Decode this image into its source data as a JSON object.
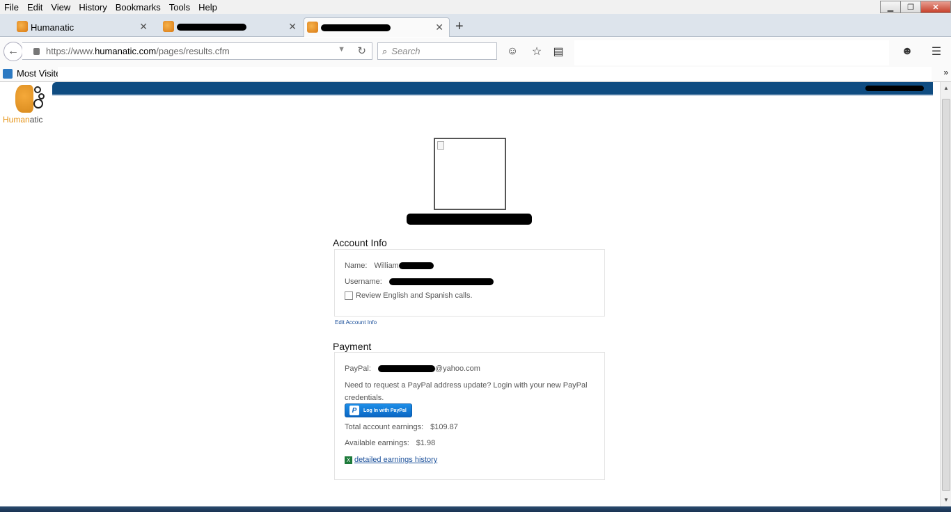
{
  "menubar": {
    "items": [
      "File",
      "Edit",
      "View",
      "History",
      "Bookmarks",
      "Tools",
      "Help"
    ]
  },
  "tabs": [
    {
      "label": "Humanatic"
    },
    {
      "label": ""
    },
    {
      "label": ""
    }
  ],
  "navbar": {
    "url_prefix": "https://www.",
    "url_host": "humanatic.com",
    "url_path": "/pages/results.cfm",
    "search_placeholder": "Search"
  },
  "bookmarks": {
    "most_visited": "Most Visite"
  },
  "logo": {
    "brand_a": "Human",
    "brand_b": "atic"
  },
  "account": {
    "section_title": "Account Info",
    "name_label": "Name:",
    "name_value": "William",
    "username_label": "Username:",
    "review_label": "Review English and Spanish calls.",
    "edit_link": "Edit Account Info"
  },
  "payment": {
    "section_title": "Payment",
    "paypal_label": "PayPal:",
    "paypal_value": "@yahoo.com",
    "update_text": "Need to request a PayPal address update? Login with your new PayPal credentials.",
    "paypal_button": "Log In with PayPal",
    "total_label": "Total account earnings:",
    "total_value": "$109.87",
    "available_label": "Available earnings:",
    "available_value": "$1.98",
    "history_link": "detailed earnings history"
  },
  "colors": {
    "header_band": "#0f4c81",
    "brand_orange": "#e59316",
    "link": "#1a4f9a"
  }
}
